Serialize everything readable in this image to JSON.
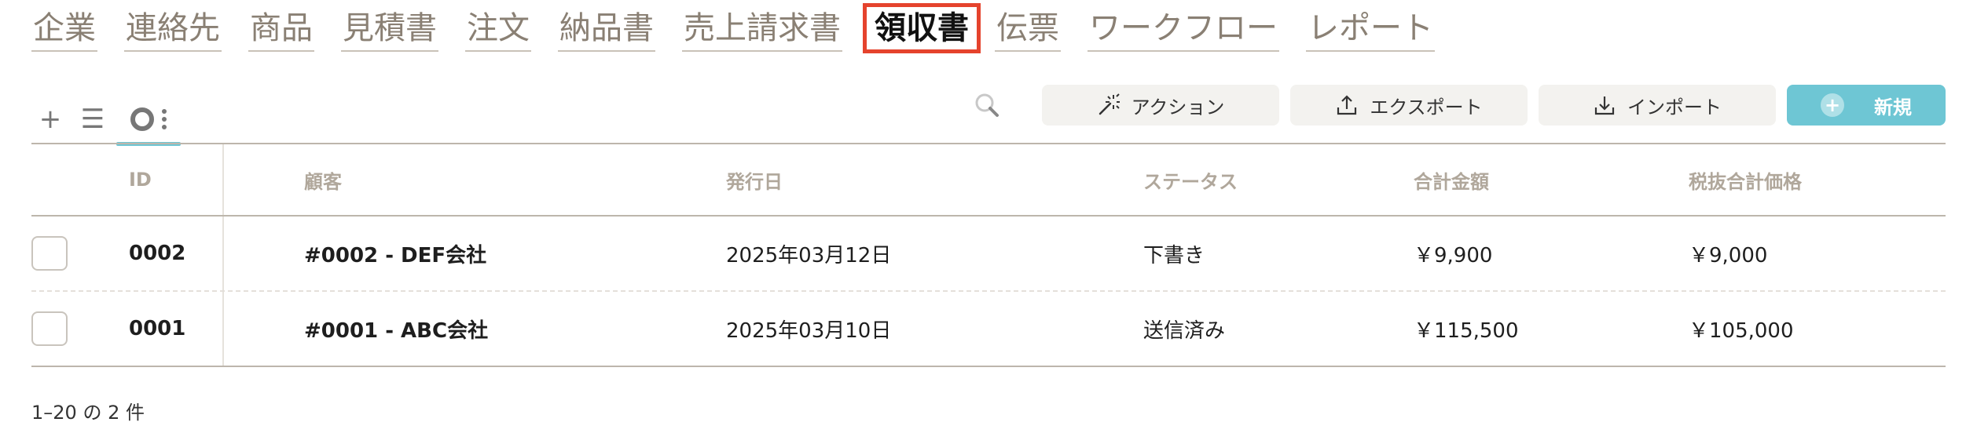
{
  "nav": {
    "items": [
      {
        "label": "企業",
        "name": "nav-item-companies"
      },
      {
        "label": "連絡先",
        "name": "nav-item-contacts"
      },
      {
        "label": "商品",
        "name": "nav-item-products"
      },
      {
        "label": "見積書",
        "name": "nav-item-quotes"
      },
      {
        "label": "注文",
        "name": "nav-item-orders"
      },
      {
        "label": "納品書",
        "name": "nav-item-delivery-notes"
      },
      {
        "label": "売上請求書",
        "name": "nav-item-invoices"
      },
      {
        "label": "領収書",
        "name": "nav-item-receipts",
        "active": true
      },
      {
        "label": "伝票",
        "name": "nav-item-slips"
      },
      {
        "label": "ワークフロー",
        "name": "nav-item-workflow"
      },
      {
        "label": "レポート",
        "name": "nav-item-reports"
      }
    ],
    "active_highlight_color": "#e5432d"
  },
  "view_tools": {
    "add_icon": "+",
    "list_icon": "☰"
  },
  "toolbar": {
    "action_label": "アクション",
    "export_label": "エクスポート",
    "import_label": "インポート",
    "new_label": "新規",
    "new_plus": "+",
    "accent_color": "#6ec6d4"
  },
  "table": {
    "columns": {
      "id": "ID",
      "customer": "顧客",
      "issue_date": "発行日",
      "status": "ステータス",
      "total": "合計金額",
      "net_total": "税抜合計価格"
    },
    "rows": [
      {
        "id": "0002",
        "customer": "#0002 - DEF会社",
        "issue_date": "2025年03月12日",
        "status": "下書き",
        "total": "￥9,900",
        "net_total": "￥9,000"
      },
      {
        "id": "0001",
        "customer": "#0001 - ABC会社",
        "issue_date": "2025年03月10日",
        "status": "送信済み",
        "total": "￥115,500",
        "net_total": "￥105,000"
      }
    ]
  },
  "pagination": {
    "summary": "1–20 の 2 件"
  }
}
